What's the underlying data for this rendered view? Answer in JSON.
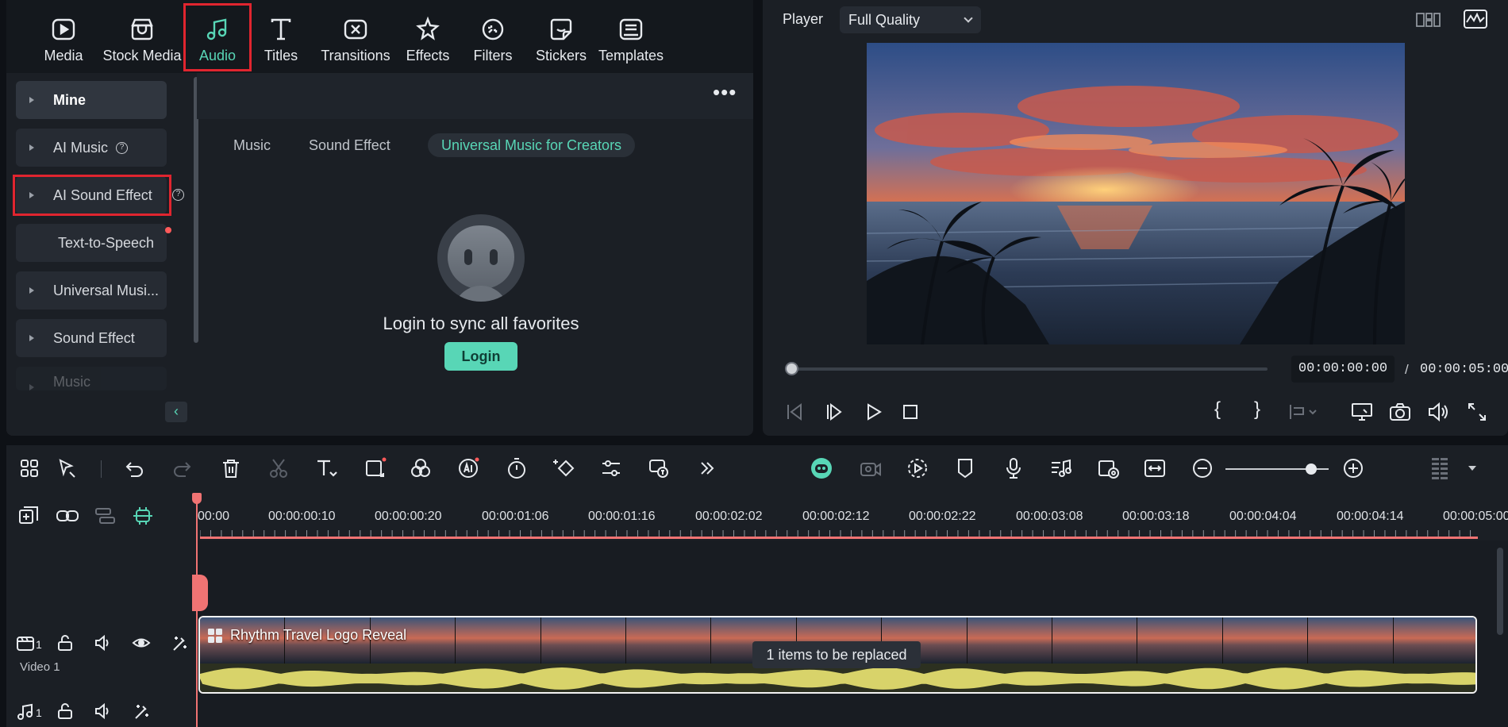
{
  "topnav": {
    "items": [
      {
        "label": "Media"
      },
      {
        "label": "Stock Media"
      },
      {
        "label": "Audio"
      },
      {
        "label": "Titles"
      },
      {
        "label": "Transitions"
      },
      {
        "label": "Effects"
      },
      {
        "label": "Filters"
      },
      {
        "label": "Stickers"
      },
      {
        "label": "Templates"
      }
    ],
    "active": "Audio"
  },
  "sidebar": {
    "items": [
      {
        "label": "Mine"
      },
      {
        "label": "AI Music"
      },
      {
        "label": "AI Sound Effect"
      },
      {
        "label": "Text-to-Speech"
      },
      {
        "label": "Universal Musi..."
      },
      {
        "label": "Sound Effect"
      },
      {
        "label": "Music"
      }
    ],
    "help_glyph": "?"
  },
  "library": {
    "tabs": [
      {
        "label": "Music"
      },
      {
        "label": "Sound Effect"
      },
      {
        "label": "Universal Music for Creators"
      }
    ],
    "active_tab": "Universal Music for Creators",
    "login_message": "Login to sync all favorites",
    "login_button": "Login",
    "more_glyph": "•••",
    "collapse_glyph": "‹"
  },
  "player": {
    "label": "Player",
    "quality": "Full Quality",
    "current_time": "00:00:00:00",
    "separator": "/",
    "total_time": "00:00:05:00",
    "progress": 0,
    "bracket_in": "{",
    "bracket_out": "}"
  },
  "timeline": {
    "ruler_ticks": [
      "00:00",
      "00:00:00:10",
      "00:00:00:20",
      "00:00:01:06",
      "00:00:01:16",
      "00:00:02:02",
      "00:00:02:12",
      "00:00:02:22",
      "00:00:03:08",
      "00:00:03:18",
      "00:00:04:04",
      "00:00:04:14",
      "00:00:05:00"
    ],
    "video_track": {
      "label": "Video 1",
      "number": "1"
    },
    "audio_track": {
      "number": "1"
    },
    "clip_title": "Rhythm Travel Logo Reveal",
    "replace_tip": "1 items to be replaced",
    "zoom_level": 0.83
  },
  "colors": {
    "accent": "#58d6b6",
    "highlight_box": "#e0252f",
    "playhead": "#f07373",
    "waveform": "#d8d36a"
  }
}
